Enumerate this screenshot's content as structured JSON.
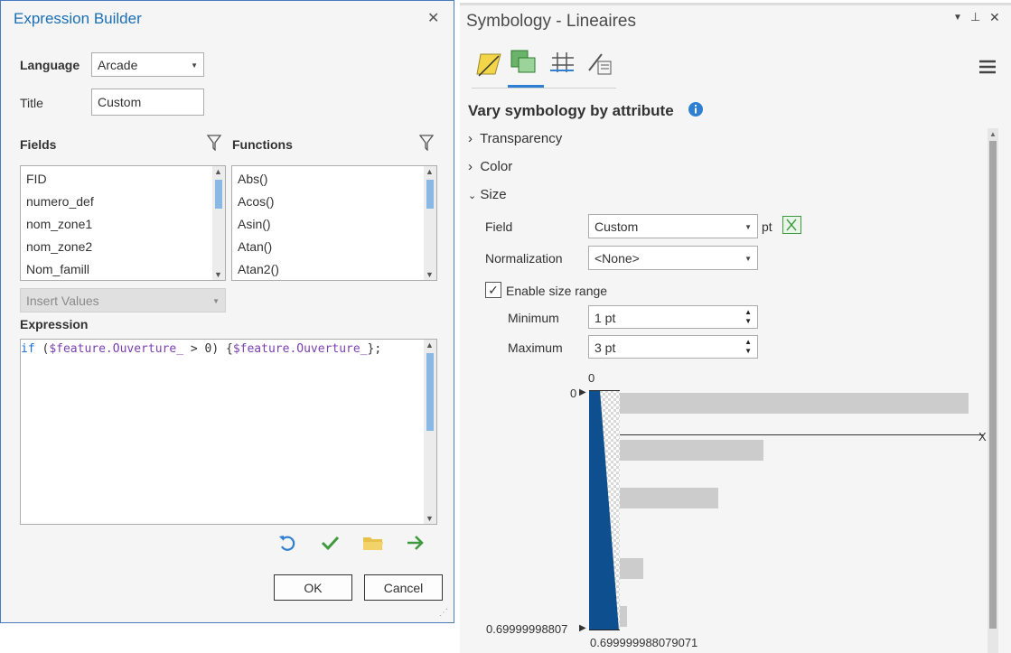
{
  "expression_builder": {
    "title": "Expression Builder",
    "language_label": "Language",
    "language_value": "Arcade",
    "title_label": "Title",
    "title_value": "Custom",
    "fields_label": "Fields",
    "fields": [
      "FID",
      "numero_def",
      "nom_zone1",
      "nom_zone2",
      "Nom_famill"
    ],
    "functions_label": "Functions",
    "functions": [
      "Abs()",
      "Acos()",
      "Asin()",
      "Atan()",
      "Atan2()"
    ],
    "insert_values": "Insert Values",
    "expression_label": "Expression",
    "expression": {
      "kw_if": "if",
      "open": " (",
      "field1": "$feature.Ouverture_",
      "op": " > ",
      "num": "0",
      "close": ") {",
      "field2": "$feature.Ouverture_",
      "end": "};"
    },
    "ok": "OK",
    "cancel": "Cancel"
  },
  "symbology": {
    "title": "Symbology - Lineaires",
    "heading": "Vary symbology by attribute",
    "sections": {
      "transparency": "Transparency",
      "color": "Color",
      "size": "Size"
    },
    "field_label": "Field",
    "field_value": "Custom",
    "unit": "pt",
    "normalization_label": "Normalization",
    "normalization_value": "<None>",
    "enable_size_range": "Enable size range",
    "enable_size_range_checked": true,
    "minimum_label": "Minimum",
    "minimum_value": "1 pt",
    "maximum_label": "Maximum",
    "maximum_value": "3 pt",
    "histogram": {
      "top_value": "0",
      "left_top": "0",
      "left_bottom": "0.69999998807",
      "bottom_value": "0.699999988079071",
      "x_label": "X"
    }
  }
}
